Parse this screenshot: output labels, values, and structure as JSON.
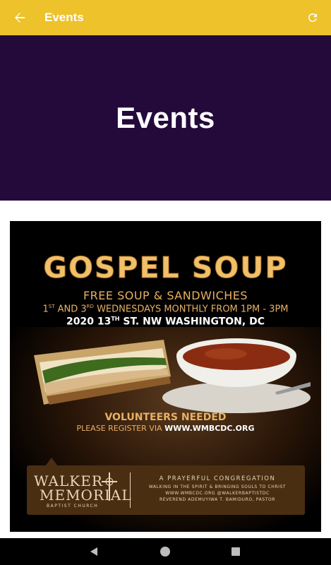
{
  "toolbar": {
    "title": "Events",
    "background": "#EDC22B",
    "back_icon": "arrow-left-icon",
    "refresh_icon": "refresh-icon"
  },
  "hero": {
    "title": "Events",
    "background": "#230A3B"
  },
  "flyer": {
    "title": "GOSPEL SOUP",
    "subtitle": "FREE SOUP & SANDWICHES",
    "schedule_pre": "1",
    "schedule_sup1": "ST",
    "schedule_mid": " AND 3",
    "schedule_sup2": "RD",
    "schedule_post": " WEDNESDAYS MONTHLY FROM 1PM - 3PM",
    "address_pre": "2020 13",
    "address_sup": "TH",
    "address_post": " ST. NW WASHINGTON, DC",
    "volunteers": "VOLUNTEERS NEEDED",
    "register_prefix": "PLEASE REGISTER VIA ",
    "register_url": "WWW.WMBCDC.ORG",
    "church": {
      "logo_line1": "WALKER",
      "logo_line2": "MEMORIAL",
      "logo_line3": "BAPTIST CHURCH",
      "tagline": "A PRAYERFUL CONGREGATION",
      "mission": "WALKING IN THE SPIRIT & BRINGING SOULS TO CHRIST",
      "contact": "WWW.WMBCDC.ORG  @WALKERBAPTISTDC",
      "pastor": "REVEREND ADEMUYIWA T. BAMIDURO, PASTOR"
    },
    "accent_color": "#E8B064"
  },
  "navbar": {
    "back_icon": "nav-back-icon",
    "home_icon": "nav-home-icon",
    "recents_icon": "nav-recents-icon"
  }
}
